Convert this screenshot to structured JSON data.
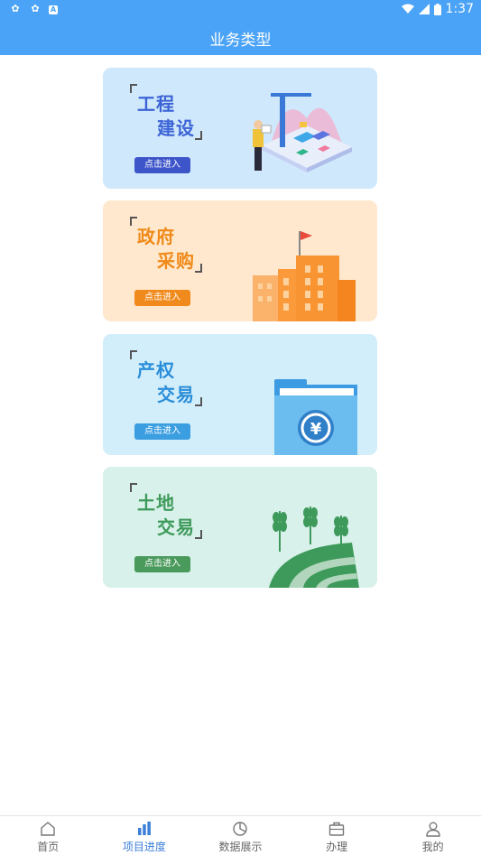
{
  "status_bar": {
    "time": "1:37",
    "app_icons": [
      "app-icon",
      "app-icon",
      "A"
    ]
  },
  "header": {
    "title": "业务类型"
  },
  "cards": [
    {
      "line1": "工程",
      "line2": "建设",
      "button": "点击进入",
      "bg": "#cfe8fb",
      "text_color": "#3b63d6",
      "button_color": "#3e55c9"
    },
    {
      "line1": "政府",
      "line2": "采购",
      "button": "点击进入",
      "bg": "#ffe8cd",
      "text_color": "#ef8a1a",
      "button_color": "#f08a1c"
    },
    {
      "line1": "产权",
      "line2": "交易",
      "button": "点击进入",
      "bg": "#d2eefb",
      "text_color": "#2b8ed8",
      "button_color": "#3b9ee0"
    },
    {
      "line1": "土地",
      "line2": "交易",
      "button": "点击进入",
      "bg": "#d8f1ea",
      "text_color": "#3e9a5a",
      "button_color": "#4a9a5c"
    }
  ],
  "bottom_nav": [
    {
      "label": "首页",
      "icon": "home-icon",
      "active": false
    },
    {
      "label": "项目进度",
      "icon": "bar-chart-icon",
      "active": true
    },
    {
      "label": "数据展示",
      "icon": "pie-chart-icon",
      "active": false
    },
    {
      "label": "办理",
      "icon": "briefcase-icon",
      "active": false
    },
    {
      "label": "我的",
      "icon": "user-icon",
      "active": false
    }
  ],
  "colors": {
    "primary": "#4aa3f6",
    "nav_active": "#3d7fd8"
  }
}
